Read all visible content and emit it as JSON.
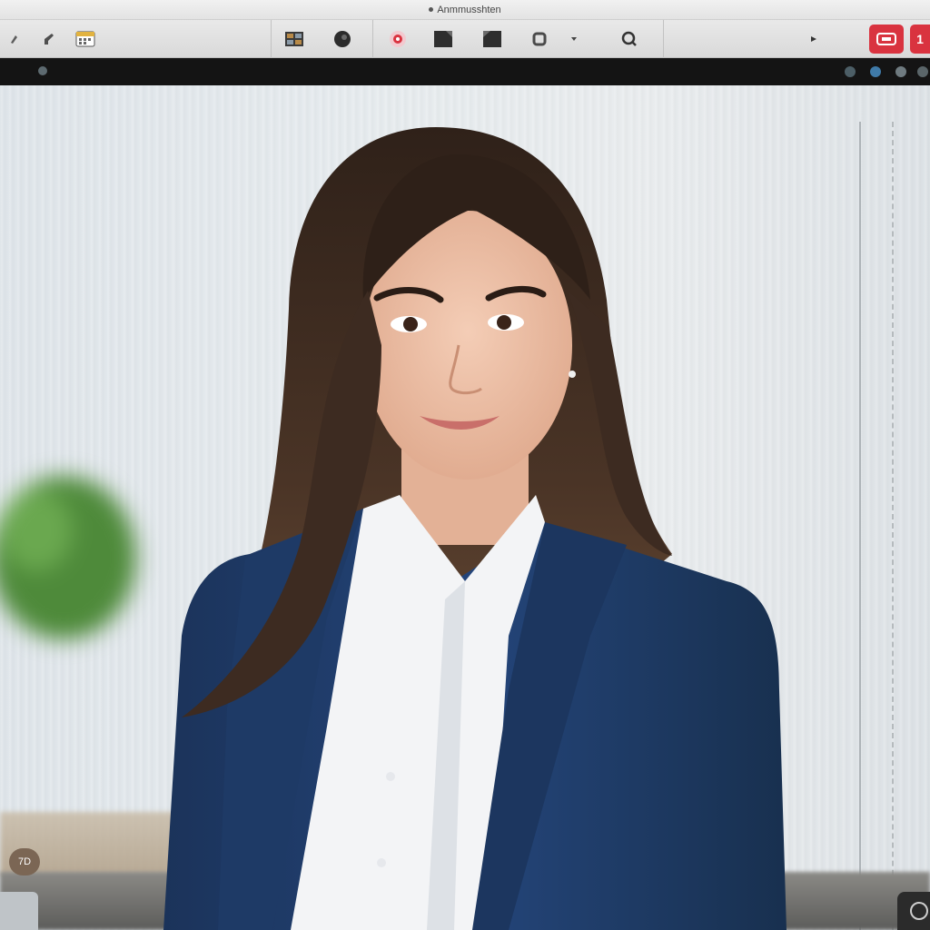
{
  "window": {
    "title": "Anmmusshten"
  },
  "toolbar": {
    "icons": [
      "pen-icon",
      "brush-icon",
      "calendar-icon",
      "grid-icon",
      "circle-record-icon",
      "flower-icon",
      "square-icon",
      "square-icon",
      "crop-icon",
      "dropdown-chevron-icon",
      "search-icon",
      "play-icon",
      "comment-icon",
      "close-tab-icon"
    ],
    "accent_color": "#d9333f",
    "red_tab_label": "1"
  },
  "status": {
    "zoom_label": "7D"
  },
  "photo": {
    "subject": "woman-portrait",
    "colors": {
      "hair": "#3a2a20",
      "blazer": "#1f3b66",
      "shirt": "#f5f6f7"
    }
  }
}
